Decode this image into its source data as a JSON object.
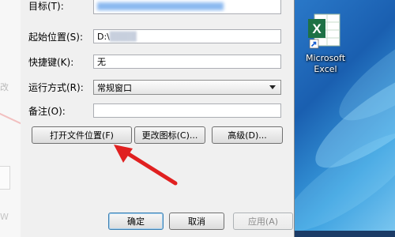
{
  "dialog": {
    "fields": {
      "target_label": "目标(T):",
      "start_label": "起始位置(S):",
      "start_value_visible": "D:\\",
      "shortcut_label": "快捷键(K):",
      "shortcut_value": "无",
      "run_label": "运行方式(R):",
      "run_value": "常规窗口",
      "comment_label": "备注(O):",
      "comment_value": ""
    },
    "buttons": {
      "open_location": "打开文件位置(F)",
      "change_icon": "更改图标(C)...",
      "advanced": "高级(D)...",
      "ok": "确定",
      "cancel": "取消",
      "apply": "应用(A)"
    }
  },
  "background": {
    "ghost_text_1": "改",
    "ghost_text_2": "W"
  },
  "desktop": {
    "icon_name": "excel-icon",
    "icon_label_line1": "Microsoft",
    "icon_label_line2": "Excel"
  },
  "colors": {
    "annotation_arrow": "#e02020",
    "excel_green": "#1e7145",
    "desktop_blue": "#1a5fb0"
  }
}
